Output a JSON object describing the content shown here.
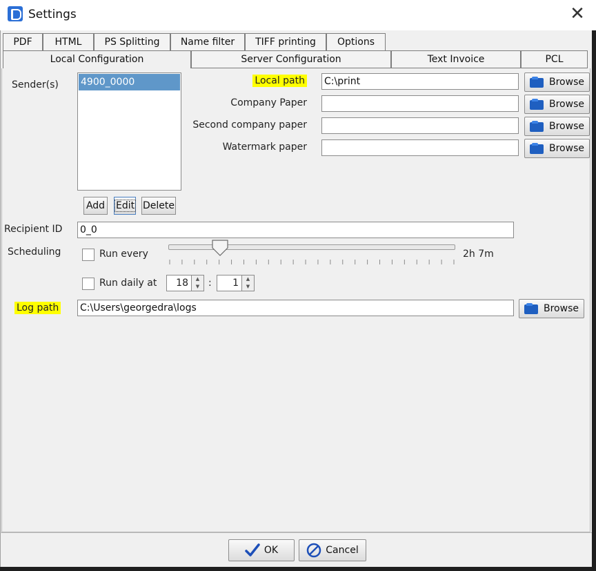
{
  "window": {
    "title": "Settings",
    "close_glyph": "✕"
  },
  "tabs_row1": [
    "PDF",
    "HTML",
    "PS Splitting",
    "Name filter",
    "TIFF printing",
    "Options"
  ],
  "tabs_row2": [
    "Local Configuration",
    "Server Configuration",
    "Text Invoice",
    "PCL"
  ],
  "active_tab": "Local Configuration",
  "senders": {
    "label": "Sender(s)",
    "items": [
      "4900_0000"
    ],
    "selected": "4900_0000"
  },
  "sender_buttons": {
    "add": "Add",
    "edit": "Edit",
    "delete": "Delete"
  },
  "paths": {
    "local_path_label": "Local path",
    "local_path_value": "C:\\print",
    "company_paper_label": "Company Paper",
    "company_paper_value": "",
    "second_paper_label": "Second company paper",
    "second_paper_value": "",
    "watermark_label": "Watermark paper",
    "watermark_value": "",
    "browse": "Browse"
  },
  "recipient": {
    "label": "Recipient ID",
    "value": "0_0"
  },
  "scheduling": {
    "label": "Scheduling",
    "run_every_label": "Run every",
    "run_every_checked": false,
    "interval_text": "2h 7m",
    "slider_fraction": 0.18,
    "run_daily_label": "Run daily at",
    "run_daily_checked": false,
    "hour": "18",
    "separator": ":",
    "minute": "1"
  },
  "log": {
    "label": "Log path",
    "value": "C:\\Users\\georgedra\\logs",
    "browse": "Browse"
  },
  "footer": {
    "ok": "OK",
    "cancel": "Cancel"
  },
  "colors": {
    "highlight": "#ffff00",
    "selection": "#5f97c9",
    "folder": "#1f5fc0",
    "ok_check": "#1d4fb8",
    "cancel_icon": "#1d4fb8"
  },
  "icons": {
    "app": "app-b-icon",
    "browse": "folder-icon",
    "ok": "checkmark-icon",
    "cancel": "no-entry-icon"
  }
}
